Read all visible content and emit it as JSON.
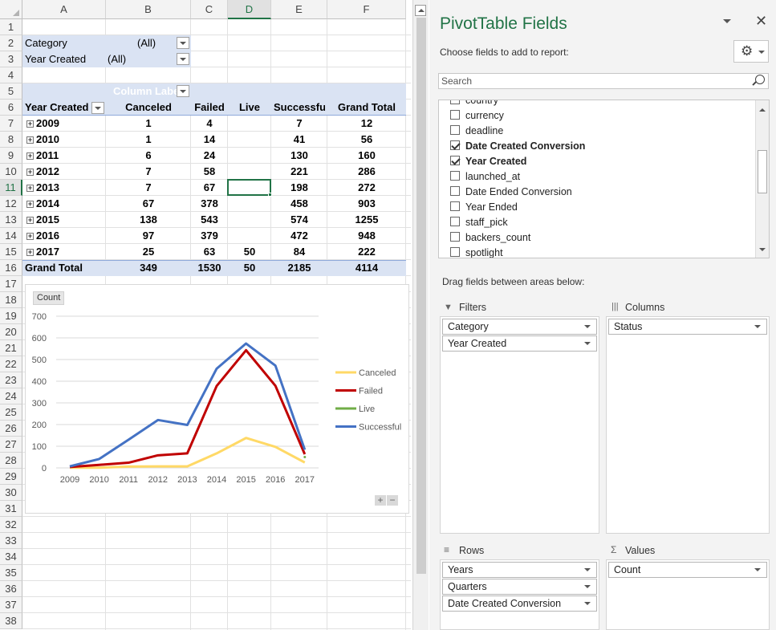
{
  "sheet": {
    "columns": [
      "A",
      "B",
      "C",
      "D",
      "E",
      "F"
    ],
    "rows": [
      "1",
      "2",
      "3",
      "4",
      "5",
      "6",
      "7",
      "8",
      "9",
      "10",
      "11",
      "12",
      "13",
      "14",
      "15",
      "16",
      "17",
      "18",
      "19",
      "20",
      "21",
      "22",
      "23",
      "24",
      "25",
      "26",
      "27",
      "28",
      "29",
      "30",
      "31",
      "32",
      "33",
      "34",
      "35",
      "36",
      "37",
      "38"
    ],
    "filters": [
      {
        "label": "Category",
        "value": "(All)"
      },
      {
        "label": "Year Created",
        "value": "(All)"
      }
    ],
    "column_labels_caption": "Column Labels",
    "pivot": {
      "row_header": "Year Created",
      "columns": [
        "Canceled",
        "Failed",
        "Live",
        "Successful",
        "Grand Total"
      ],
      "rows": [
        {
          "year": "2009",
          "values": [
            "1",
            "4",
            "",
            "7",
            "12"
          ]
        },
        {
          "year": "2010",
          "values": [
            "1",
            "14",
            "",
            "41",
            "56"
          ]
        },
        {
          "year": "2011",
          "values": [
            "6",
            "24",
            "",
            "130",
            "160"
          ]
        },
        {
          "year": "2012",
          "values": [
            "7",
            "58",
            "",
            "221",
            "286"
          ]
        },
        {
          "year": "2013",
          "values": [
            "7",
            "67",
            "",
            "198",
            "272"
          ]
        },
        {
          "year": "2014",
          "values": [
            "67",
            "378",
            "",
            "458",
            "903"
          ]
        },
        {
          "year": "2015",
          "values": [
            "138",
            "543",
            "",
            "574",
            "1255"
          ]
        },
        {
          "year": "2016",
          "values": [
            "97",
            "379",
            "",
            "472",
            "948"
          ]
        },
        {
          "year": "2017",
          "values": [
            "25",
            "63",
            "50",
            "84",
            "222"
          ]
        }
      ],
      "total_label": "Grand Total",
      "totals": [
        "349",
        "1530",
        "50",
        "2185",
        "4114"
      ]
    }
  },
  "chart_data": {
    "type": "line",
    "field_button": "Count",
    "categories": [
      "2009",
      "2010",
      "2011",
      "2012",
      "2013",
      "2014",
      "2015",
      "2016",
      "2017"
    ],
    "ylim": [
      0,
      700
    ],
    "yticks": [
      0,
      100,
      200,
      300,
      400,
      500,
      600,
      700
    ],
    "grid": true,
    "legend_position": "right",
    "series": [
      {
        "name": "Canceled",
        "color": "#ffd966",
        "values": [
          1,
          1,
          6,
          7,
          7,
          67,
          138,
          97,
          25
        ]
      },
      {
        "name": "Failed",
        "color": "#c00000",
        "values": [
          4,
          14,
          24,
          58,
          67,
          378,
          543,
          379,
          63
        ]
      },
      {
        "name": "Live",
        "color": "#70ad47",
        "values": [
          null,
          null,
          null,
          null,
          null,
          null,
          null,
          null,
          50
        ]
      },
      {
        "name": "Successful",
        "color": "#4472c4",
        "values": [
          7,
          41,
          130,
          221,
          198,
          458,
          574,
          472,
          84
        ]
      }
    ]
  },
  "panel": {
    "title": "PivotTable Fields",
    "choose_text": "Choose fields to add to report:",
    "search_placeholder": "Search",
    "fields": [
      {
        "name": "country",
        "checked": false,
        "bold": false
      },
      {
        "name": "currency",
        "checked": false,
        "bold": false
      },
      {
        "name": "deadline",
        "checked": false,
        "bold": false
      },
      {
        "name": "Date Created Conversion",
        "checked": true,
        "bold": true
      },
      {
        "name": "Year Created",
        "checked": true,
        "bold": true
      },
      {
        "name": "launched_at",
        "checked": false,
        "bold": false
      },
      {
        "name": "Date Ended Conversion",
        "checked": false,
        "bold": false
      },
      {
        "name": "Year Ended",
        "checked": false,
        "bold": false
      },
      {
        "name": "staff_pick",
        "checked": false,
        "bold": false
      },
      {
        "name": "backers_count",
        "checked": false,
        "bold": false
      },
      {
        "name": "spotlight",
        "checked": false,
        "bold": false
      }
    ],
    "drag_text": "Drag fields between areas below:",
    "filters_label": "Filters",
    "columns_label": "Columns",
    "rows_label": "Rows",
    "values_label": "Values",
    "filters": [
      "Category",
      "Year Created"
    ],
    "columns": [
      "Status"
    ],
    "rows": [
      "Years",
      "Quarters",
      "Date Created Conversion"
    ],
    "values": [
      "Count"
    ]
  }
}
